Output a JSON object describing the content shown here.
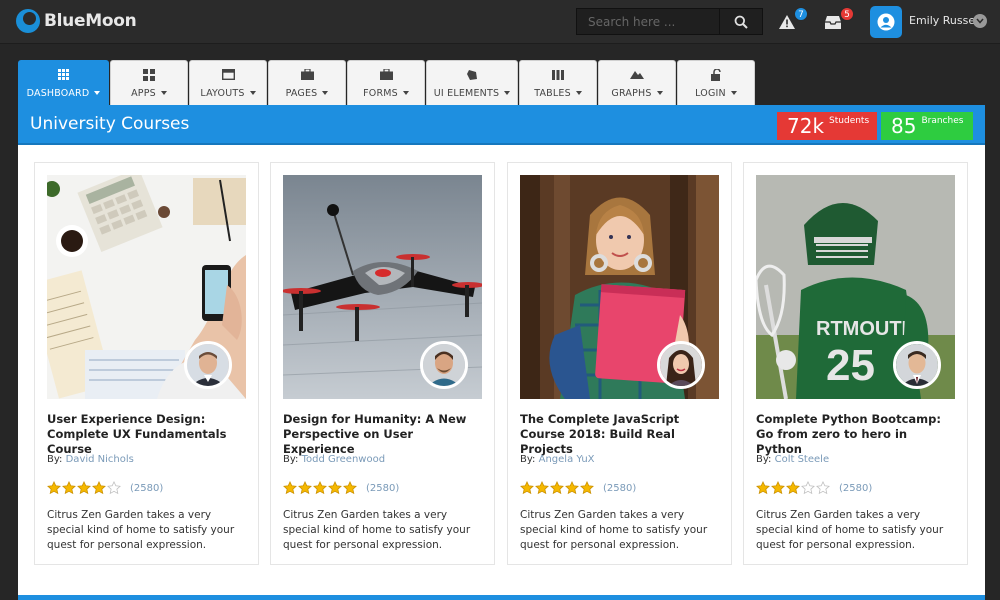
{
  "brand": {
    "name": "BlueMoon"
  },
  "search": {
    "placeholder": "Search here ..."
  },
  "alerts": {
    "count": "7",
    "color": "#1e8fe0"
  },
  "inbox": {
    "count": "5",
    "color": "#e53935"
  },
  "user": {
    "name": "Emily Russell"
  },
  "nav": {
    "tabs": [
      {
        "label": "DASHBOARD",
        "icon": "grid-icon",
        "active": true
      },
      {
        "label": "APPS",
        "icon": "apps-icon"
      },
      {
        "label": "LAYOUTS",
        "icon": "layout-icon"
      },
      {
        "label": "PAGES",
        "icon": "briefcase-icon"
      },
      {
        "label": "FORMS",
        "icon": "briefcase-icon"
      },
      {
        "label": "UI ELEMENTS",
        "icon": "diamond-icon"
      },
      {
        "label": "TABLES",
        "icon": "columns-icon"
      },
      {
        "label": "GRAPHS",
        "icon": "mountain-icon"
      },
      {
        "label": "LOGIN",
        "icon": "unlock-icon"
      }
    ]
  },
  "panel": {
    "title": "University Courses",
    "stats": [
      {
        "value": "72k",
        "caption": "Students",
        "color": "#e53935"
      },
      {
        "value": "85",
        "caption": "Branches",
        "color": "#2ecc40"
      }
    ]
  },
  "courses": [
    {
      "title": "User Experience Design: Complete UX Fundamentals Course",
      "by_label": "By:",
      "author": "David Nichols",
      "rating": 4,
      "count": "(2580)",
      "description": "Citrus Zen Garden takes a very special kind of home to satisfy your quest for personal expression."
    },
    {
      "title": "Design for Humanity: A New Perspective on User Experience",
      "by_label": "By:",
      "author": "Todd Greenwood",
      "rating": 5,
      "count": "(2580)",
      "description": "Citrus Zen Garden takes a very special kind of home to satisfy your quest for personal expression."
    },
    {
      "title": "The Complete JavaScript Course 2018: Build Real Projects",
      "by_label": "By:",
      "author": "Angela YuX",
      "rating": 5,
      "count": "(2580)",
      "description": "Citrus Zen Garden takes a very special kind of home to satisfy your quest for personal expression."
    },
    {
      "title": "Complete Python Bootcamp: Go from zero to hero in Python",
      "by_label": "By:",
      "author": "Colt Steele",
      "rating": 3,
      "count": "(2580)",
      "description": "Citrus Zen Garden takes a very special kind of home to satisfy your quest for personal expression."
    }
  ]
}
